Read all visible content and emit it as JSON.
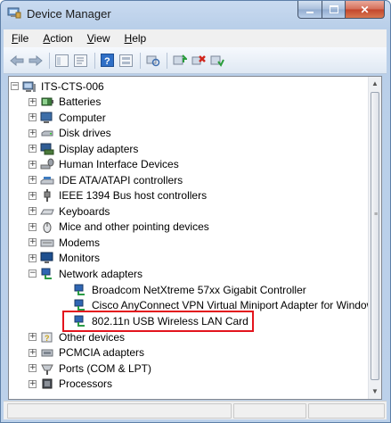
{
  "window": {
    "title": "Device Manager"
  },
  "menu": {
    "items": [
      {
        "label": "File",
        "key": "F",
        "rest": "ile"
      },
      {
        "label": "Action",
        "key": "A",
        "rest": "ction"
      },
      {
        "label": "View",
        "key": "V",
        "rest": "iew"
      },
      {
        "label": "Help",
        "key": "H",
        "rest": "elp"
      }
    ]
  },
  "toolbar": {
    "icons": [
      "back-arrow-icon",
      "forward-arrow-icon",
      "show-hide-console-tree-icon",
      "properties-icon",
      "help-icon",
      "view-icon",
      "scan-hardware-icon",
      "update-driver-icon",
      "uninstall-icon",
      "enable-device-icon"
    ]
  },
  "tree": {
    "root": "ITS-CTS-006",
    "categories": [
      "Batteries",
      "Computer",
      "Disk drives",
      "Display adapters",
      "Human Interface Devices",
      "IDE ATA/ATAPI controllers",
      "IEEE 1394 Bus host controllers",
      "Keyboards",
      "Mice and other pointing devices",
      "Modems",
      "Monitors",
      "Network adapters"
    ],
    "network_adapters": [
      "Broadcom NetXtreme 57xx Gigabit Controller",
      "Cisco AnyConnect VPN Virtual Miniport Adapter for Windows",
      "802.11n USB Wireless LAN Card"
    ],
    "after": [
      "Other devices",
      "PCMCIA adapters",
      "Ports (COM & LPT)",
      "Processors"
    ]
  },
  "colors": {
    "highlight": "#e3141d",
    "title_bar": "#bcd1ea"
  }
}
